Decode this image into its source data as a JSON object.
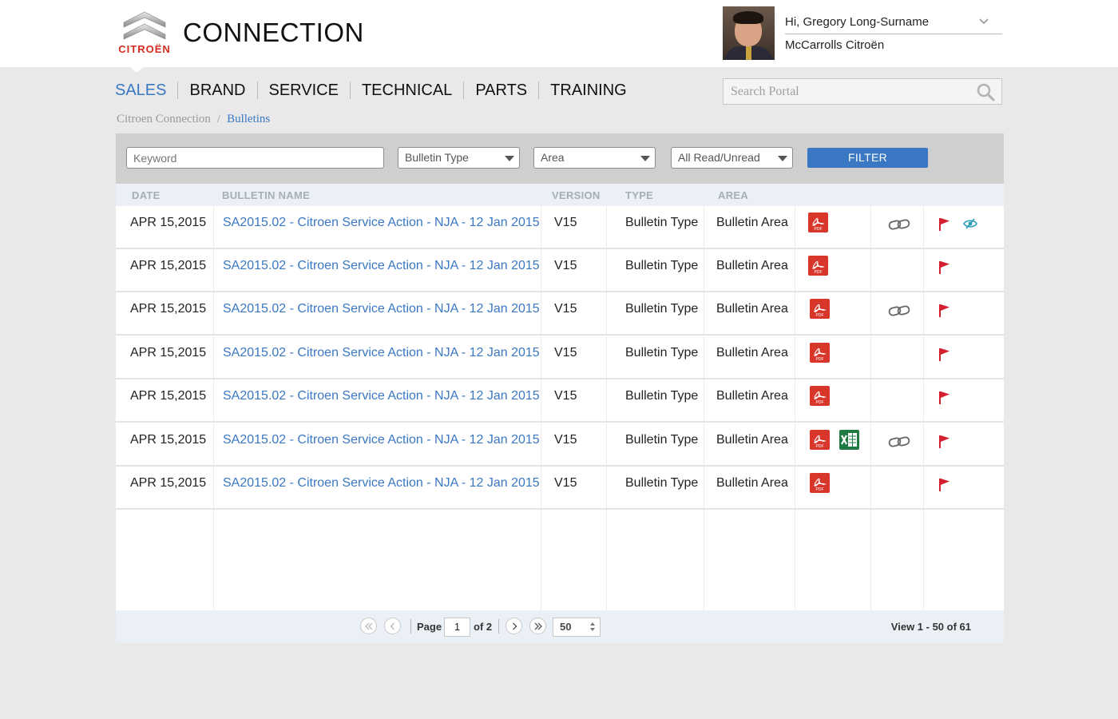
{
  "brand": {
    "logo_text": "CITROËN",
    "title": "CONNECTION",
    "colors": {
      "brand_red": "#d52b1e",
      "accent_blue": "#3a78c3"
    }
  },
  "user": {
    "greeting": "Hi, Gregory Long-Surname",
    "dealer": "McCarrolls Citroën"
  },
  "nav": {
    "items": [
      {
        "label": "SALES",
        "active": true
      },
      {
        "label": "BRAND",
        "active": false
      },
      {
        "label": "SERVICE",
        "active": false
      },
      {
        "label": "TECHNICAL",
        "active": false
      },
      {
        "label": "PARTS",
        "active": false
      },
      {
        "label": "TRAINING",
        "active": false
      }
    ]
  },
  "search": {
    "placeholder": "Search Portal"
  },
  "breadcrumb": {
    "home": "Citroen Connection",
    "separator": "/",
    "current": "Bulletins"
  },
  "filters": {
    "keyword_placeholder": "Keyword",
    "bulletin_type": "Bulletin Type",
    "area": "Area",
    "read_state": "All Read/Unread",
    "button_label": "FILTER"
  },
  "table": {
    "headers": {
      "date": "DATE",
      "name": "BULLETIN NAME",
      "version": "VERSION",
      "type": "TYPE",
      "area": "AREA"
    },
    "rows": [
      {
        "date": "APR 15,2015",
        "name": "SA2015.02 - Citroen Service Action - NJA - 12 Jan 2015",
        "version": "V15",
        "type": "Bulletin Type",
        "area": "Bulletin Area",
        "files": [
          "pdf-icon"
        ],
        "has_link": true,
        "flagged": true,
        "unread_icon": true
      },
      {
        "date": "APR 15,2015",
        "name": "SA2015.02 - Citroen Service Action - NJA - 12 Jan 2015",
        "version": "V15",
        "type": "Bulletin Type",
        "area": "Bulletin Area",
        "files": [
          "pdf-icon"
        ],
        "has_link": false,
        "flagged": true,
        "unread_icon": false
      },
      {
        "date": "APR 15,2015",
        "name": "SA2015.02 - Citroen Service Action - NJA - 12 Jan 2015",
        "version": "V15",
        "type": "Bulletin Type",
        "area": "Bulletin Area",
        "files": [
          "pdf-icon"
        ],
        "has_link": true,
        "flagged": true,
        "unread_icon": false
      },
      {
        "date": "APR 15,2015",
        "name": "SA2015.02 - Citroen Service Action - NJA - 12 Jan 2015",
        "version": "V15",
        "type": "Bulletin Type",
        "area": "Bulletin Area",
        "files": [
          "pdf-icon"
        ],
        "has_link": false,
        "flagged": true,
        "unread_icon": false
      },
      {
        "date": "APR 15,2015",
        "name": "SA2015.02 - Citroen Service Action - NJA - 12 Jan 2015",
        "version": "V15",
        "type": "Bulletin Type",
        "area": "Bulletin Area",
        "files": [
          "pdf-icon"
        ],
        "has_link": false,
        "flagged": true,
        "unread_icon": false
      },
      {
        "date": "APR 15,2015",
        "name": "SA2015.02 - Citroen Service Action - NJA - 12 Jan 2015",
        "version": "V15",
        "type": "Bulletin Type",
        "area": "Bulletin Area",
        "files": [
          "pdf-icon",
          "excel-icon"
        ],
        "has_link": true,
        "flagged": true,
        "unread_icon": false
      },
      {
        "date": "APR 15,2015",
        "name": "SA2015.02 - Citroen Service Action - NJA - 12 Jan 2015",
        "version": "V15",
        "type": "Bulletin Type",
        "area": "Bulletin Area",
        "files": [
          "pdf-icon"
        ],
        "has_link": false,
        "flagged": true,
        "unread_icon": false
      }
    ]
  },
  "pagination": {
    "page_label": "Page",
    "current_page": "1",
    "of_label": "of 2",
    "page_size": "50",
    "view_count": "View 1 - 50 of 61"
  }
}
